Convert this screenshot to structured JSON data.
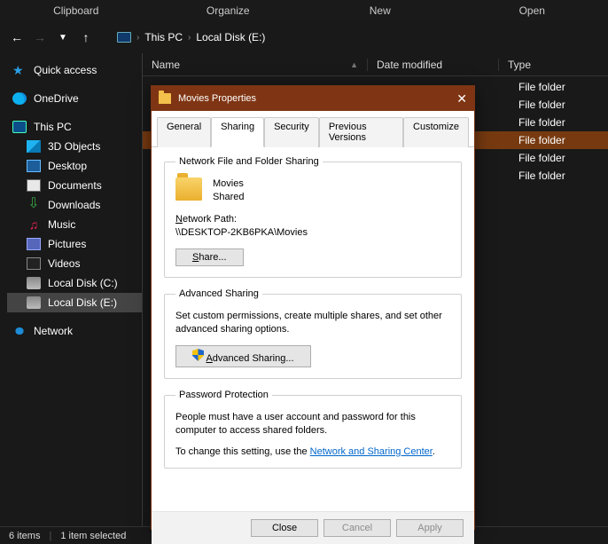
{
  "ribbon": {
    "items": [
      "Clipboard",
      "Organize",
      "New",
      "Open"
    ]
  },
  "breadcrumb": {
    "root": "This PC",
    "path": "Local Disk (E:)"
  },
  "sidebar": {
    "quick_access": "Quick access",
    "onedrive": "OneDrive",
    "this_pc": "This PC",
    "children": [
      {
        "label": "3D Objects"
      },
      {
        "label": "Desktop"
      },
      {
        "label": "Documents"
      },
      {
        "label": "Downloads"
      },
      {
        "label": "Music"
      },
      {
        "label": "Pictures"
      },
      {
        "label": "Videos"
      },
      {
        "label": "Local Disk (C:)"
      },
      {
        "label": "Local Disk (E:)"
      }
    ],
    "network": "Network"
  },
  "columns": {
    "name": "Name",
    "date": "Date modified",
    "type": "Type"
  },
  "files": {
    "type_label": "File folder",
    "count_visible": 6,
    "selected_index": 3
  },
  "statusbar": {
    "count": "6 items",
    "selection": "1 item selected"
  },
  "dialog": {
    "title": "Movies Properties",
    "tabs": [
      "General",
      "Sharing",
      "Security",
      "Previous Versions",
      "Customize"
    ],
    "active_tab": 1,
    "group_network": {
      "legend": "Network File and Folder Sharing",
      "name": "Movies",
      "state": "Shared",
      "path_label_pre": "N",
      "path_label_rest": "etwork Path:",
      "path": "\\\\DESKTOP-2KB6PKA\\Movies",
      "share_btn_pre": "S",
      "share_btn_rest": "hare..."
    },
    "group_advanced": {
      "legend": "Advanced Sharing",
      "desc": "Set custom permissions, create multiple shares, and set other advanced sharing options.",
      "btn_pre": "A",
      "btn_rest": "dvanced Sharing..."
    },
    "group_password": {
      "legend": "Password Protection",
      "desc": "People must have a user account and password for this computer to access shared folders.",
      "hint_prefix": "To change this setting, use the ",
      "link": "Network and Sharing Center",
      "hint_suffix": "."
    },
    "buttons": {
      "close": "Close",
      "cancel": "Cancel",
      "apply": "Apply"
    }
  }
}
